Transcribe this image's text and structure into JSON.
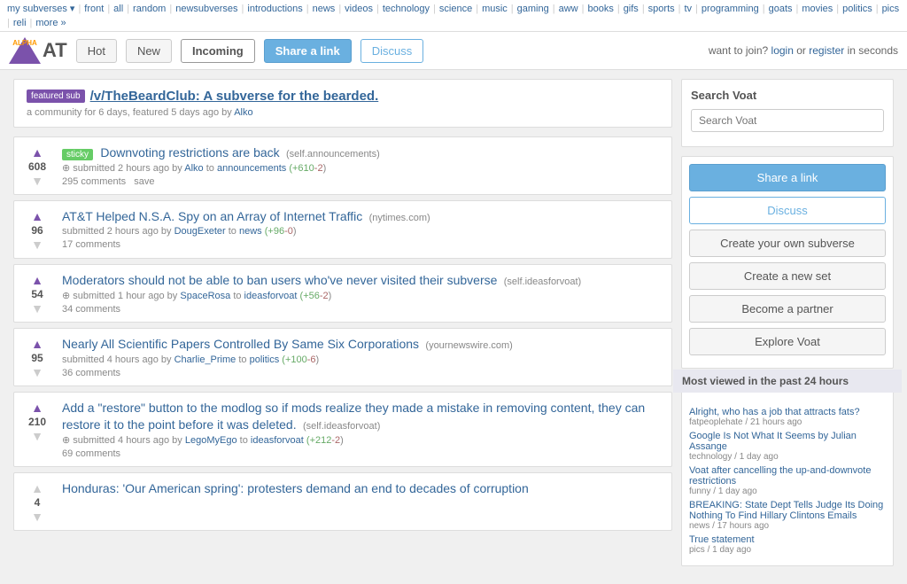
{
  "topnav": {
    "prefix": "my subverses",
    "items": [
      "front",
      "all",
      "random",
      "newsubverses",
      "introductions",
      "news",
      "videos",
      "technology",
      "science",
      "music",
      "gaming",
      "aww",
      "books",
      "gifs",
      "sports",
      "tv",
      "programming",
      "goats",
      "movies",
      "politics",
      "pics",
      "reli",
      "more"
    ],
    "more_label": "more »"
  },
  "header": {
    "logo_text": "V",
    "logo_alpha": "ALPHA",
    "logo_main": "AT",
    "tabs": [
      "Hot",
      "New",
      "Incoming",
      "Share a link",
      "Discuss"
    ],
    "active_tab": "Incoming",
    "join_text": "want to join?",
    "login_text": "login",
    "or_text": "or",
    "register_text": "register",
    "seconds_text": "in seconds"
  },
  "featured": {
    "label": "featured sub",
    "title": "/v/TheBeardClub: A subverse for the bearded.",
    "meta": "a community for 6 days, featured 5 days ago by",
    "author": "Alko"
  },
  "posts": [
    {
      "id": 1,
      "sticky": true,
      "sticky_label": "sticky",
      "title": "Downvoting restrictions are back",
      "domain": "(self.announcements)",
      "votes": "608",
      "submitted_text": "submitted 2 hours ago by",
      "author": "Alko",
      "sub_text": "to",
      "sub": "announcements",
      "score": "+610",
      "score_minus": "-2",
      "comments": "295 comments",
      "save_label": "save"
    },
    {
      "id": 2,
      "sticky": false,
      "title": "AT&T Helped N.S.A. Spy on an Array of Internet Traffic",
      "domain": "(nytimes.com)",
      "votes": "96",
      "submitted_text": "submitted 2 hours ago by",
      "author": "DougExeter",
      "sub_text": "to",
      "sub": "news",
      "score": "+96",
      "score_minus": "-0",
      "comments": "17 comments"
    },
    {
      "id": 3,
      "sticky": false,
      "title": "Moderators should not be able to ban users who've never visited their subverse",
      "domain": "(self.ideasforvoat)",
      "votes": "54",
      "submitted_text": "submitted 1 hour ago by",
      "author": "SpaceRosa",
      "sub_text": "to",
      "sub": "ideasforvoat",
      "score": "+56",
      "score_minus": "-2",
      "comments": "34 comments"
    },
    {
      "id": 4,
      "sticky": false,
      "title": "Nearly All Scientific Papers Controlled By Same Six Corporations",
      "domain": "(yournewswire.com)",
      "votes": "95",
      "submitted_text": "submitted 4 hours ago by",
      "author": "Charlie_Prime",
      "sub_text": "to",
      "sub": "politics",
      "score": "+100",
      "score_minus": "-6",
      "comments": "36 comments"
    },
    {
      "id": 5,
      "sticky": false,
      "title": "Add a \"restore\" button to the modlog so if mods realize they made a mistake in removing content, they can restore it to the point before it was deleted.",
      "domain": "(self.ideasforvoat)",
      "votes": "210",
      "submitted_text": "submitted 4 hours ago by",
      "author": "LegoMyEgo",
      "sub_text": "to",
      "sub": "ideasforvoat",
      "score": "+212",
      "score_minus": "-2",
      "comments": "69 comments"
    },
    {
      "id": 6,
      "sticky": false,
      "title": "Honduras: 'Our American spring': protesters demand an end to decades of corruption",
      "domain": "",
      "votes": "4",
      "submitted_text": "",
      "author": "",
      "sub_text": "",
      "sub": "",
      "score": "",
      "score_minus": "",
      "comments": ""
    }
  ],
  "sidebar": {
    "search_title": "Search Voat",
    "search_placeholder": "Search Voat",
    "share_link": "Share a link",
    "discuss": "Discuss",
    "create_subverse": "Create your own subverse",
    "create_set": "Create a new set",
    "become_partner": "Become a partner",
    "explore": "Explore Voat",
    "most_viewed_title": "Most viewed in the past 24 hours",
    "most_viewed": [
      {
        "title": "Alright, who has a job that attracts fats?",
        "sub": "fatpeoplehate",
        "time": "21 hours ago"
      },
      {
        "title": "Google Is Not What It Seems  by Julian Assange",
        "sub": "technology",
        "time": "1 day ago"
      },
      {
        "title": "Voat after cancelling the up-and-downvote restrictions",
        "sub": "funny",
        "time": "1 day ago"
      },
      {
        "title": "BREAKING: State Dept Tells Judge Its Doing Nothing To Find Hillary Clintons Emails",
        "sub": "news",
        "time": "17 hours ago"
      },
      {
        "title": "True statement",
        "sub": "pics",
        "time": "1 day ago"
      }
    ]
  }
}
